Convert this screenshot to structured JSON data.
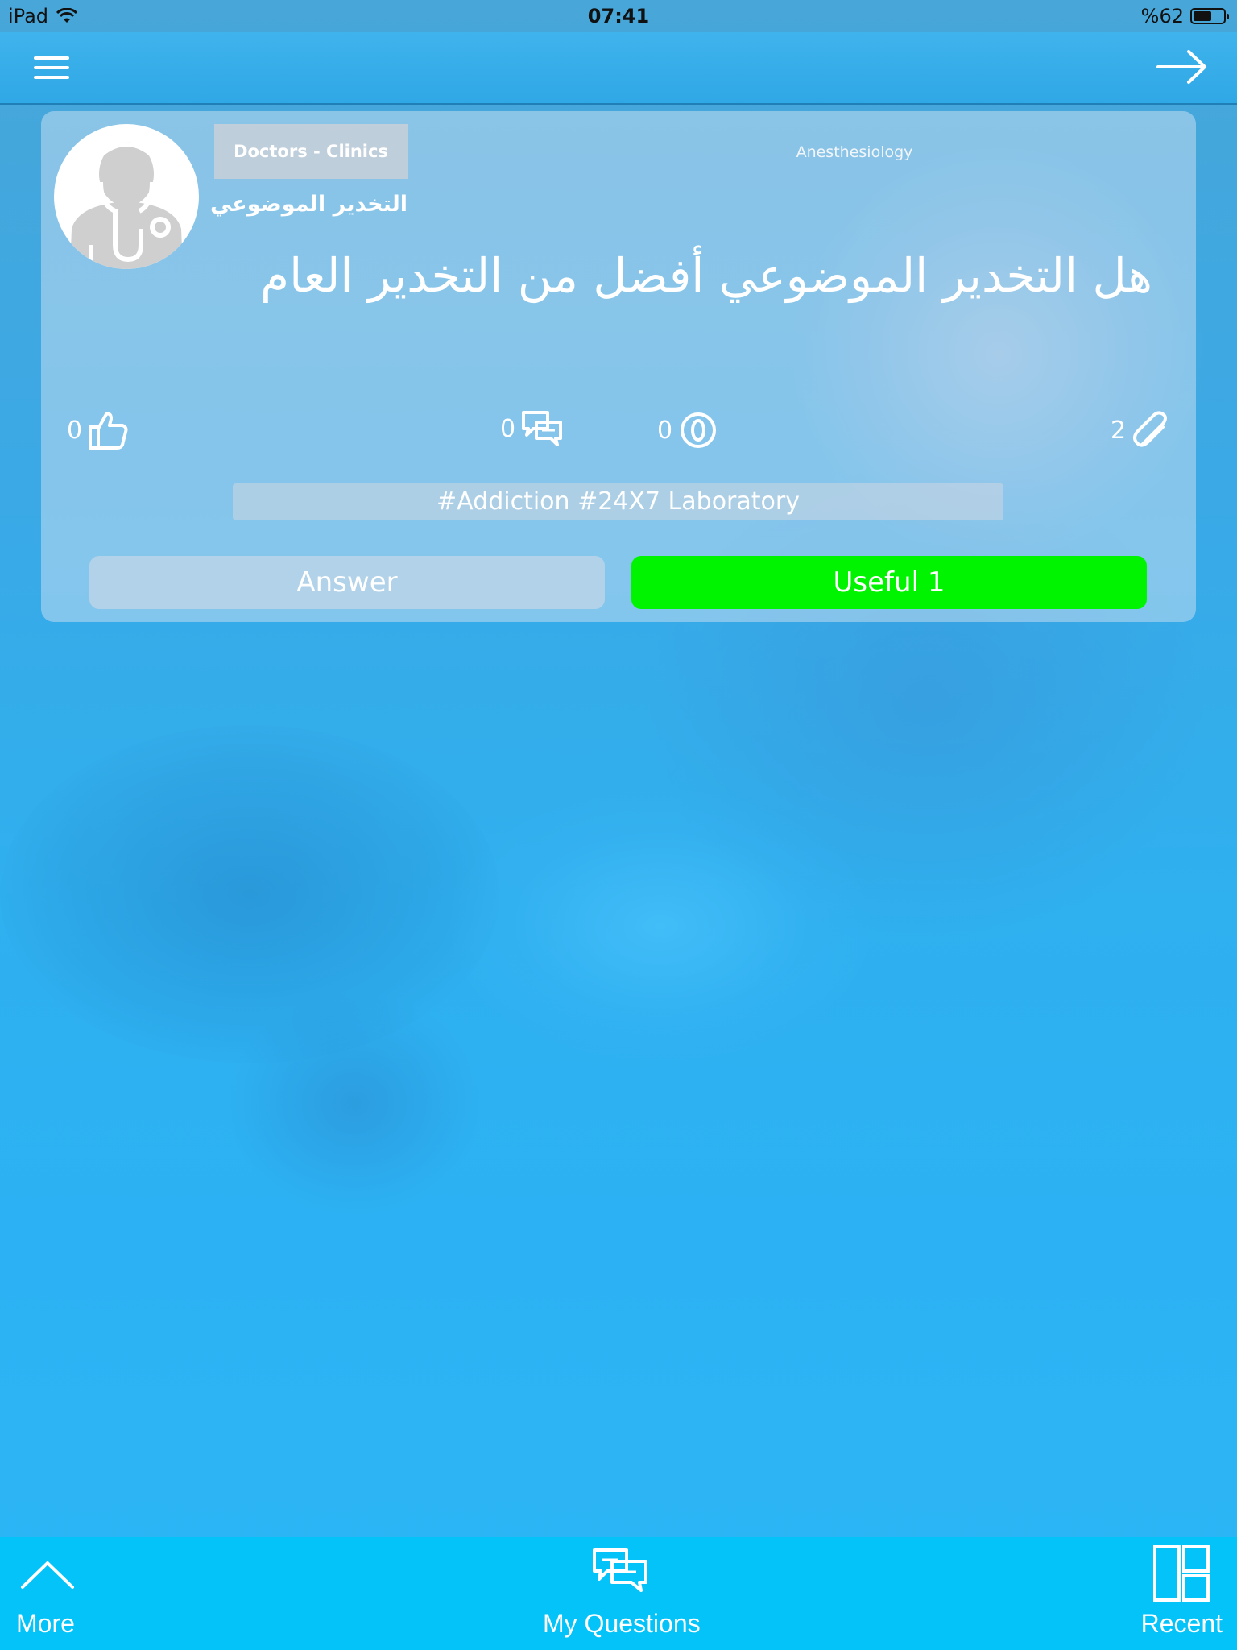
{
  "status_bar": {
    "device": "iPad",
    "time": "07:41",
    "battery": "%62",
    "battery_level": 0.62
  },
  "nav": {
    "menu_icon": "hamburger-menu-icon",
    "back_icon": "arrow-right-icon"
  },
  "post": {
    "avatar_icon": "doctor-avatar-icon",
    "category": "Doctors - Clinics",
    "specialty": "Anesthesiology",
    "subtitle": "التخدير الموضوعي",
    "question": "هل التخدير الموضوعي أفضل من التخدير العام",
    "stats": {
      "likes": "0",
      "comments": "0",
      "views": "0",
      "attachments": "2"
    },
    "tags": "#Addiction #24X7 Laboratory",
    "answer_label": "Answer",
    "useful_label": "Useful  1"
  },
  "tabs": [
    {
      "label": "More",
      "icon": "chevron-up-icon"
    },
    {
      "label": "My Questions",
      "icon": "chat-bubbles-icon"
    },
    {
      "label": "Recent",
      "icon": "layout-grid-icon"
    }
  ],
  "colors": {
    "tab_bar": "#04c3f9",
    "useful_button": "#00f400",
    "nav_bar": "#35ade8"
  }
}
